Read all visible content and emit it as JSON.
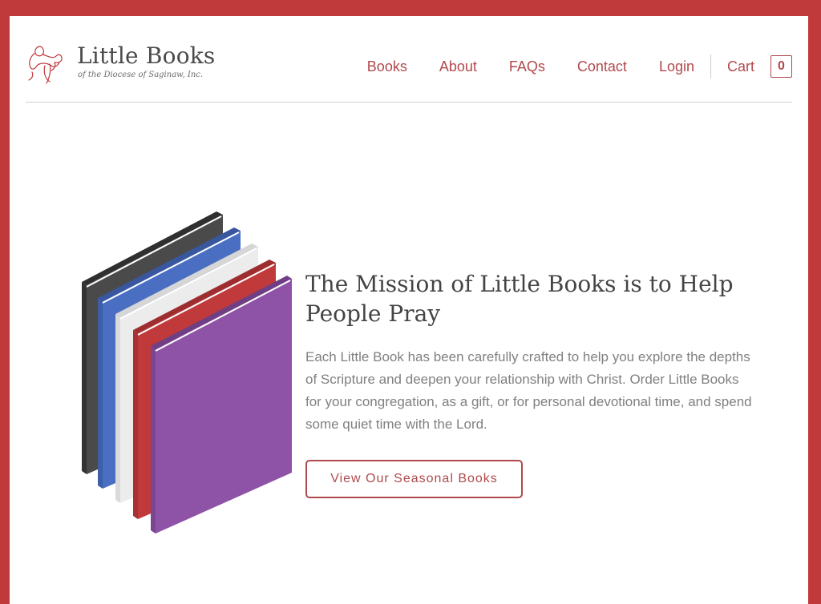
{
  "brand": {
    "name": "Little Books",
    "subtitle": "of the Diocese of Saginaw, Inc.",
    "logo_icon": "mother-and-child-line-art-icon"
  },
  "nav": {
    "items": [
      {
        "label": "Books"
      },
      {
        "label": "About"
      },
      {
        "label": "FAQs"
      },
      {
        "label": "Contact"
      },
      {
        "label": "Login"
      }
    ],
    "cart_label": "Cart",
    "cart_count": "0"
  },
  "hero": {
    "title": "The Mission of Little Books is to Help People Pray",
    "body": "Each Little Book has been carefully crafted to help you explore the depths of Scripture and deepen your relationship with Christ. Order Little Books for your congregation, as a gift, or for personal devotional time, and spend some quiet time with the Lord.",
    "cta_label": "View Our Seasonal Books",
    "illustration": "stacked-books-illustration"
  },
  "colors": {
    "frame_border": "#c0393b",
    "accent": "#b0494d",
    "book_colors": [
      "#4a4a4a",
      "#4a6fc2",
      "#ececec",
      "#c0393b",
      "#8e52a6"
    ]
  }
}
